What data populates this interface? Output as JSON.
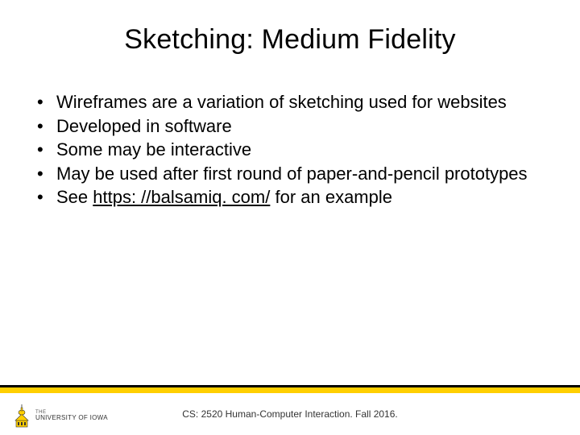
{
  "title": "Sketching: Medium Fidelity",
  "bullets": [
    {
      "text": "Wireframes are a variation of sketching used for websites"
    },
    {
      "text": "Developed in software"
    },
    {
      "text": "Some may be interactive"
    },
    {
      "text": "May be used after first round of paper-and-pencil prototypes"
    },
    {
      "prefix": "See ",
      "link": "https: //balsamiq. com/",
      "suffix": " for an example"
    }
  ],
  "footer": "CS: 2520 Human-Computer Interaction. Fall 2016.",
  "logo": {
    "line1": "THE",
    "line2": "UNIVERSITY OF IOWA"
  }
}
